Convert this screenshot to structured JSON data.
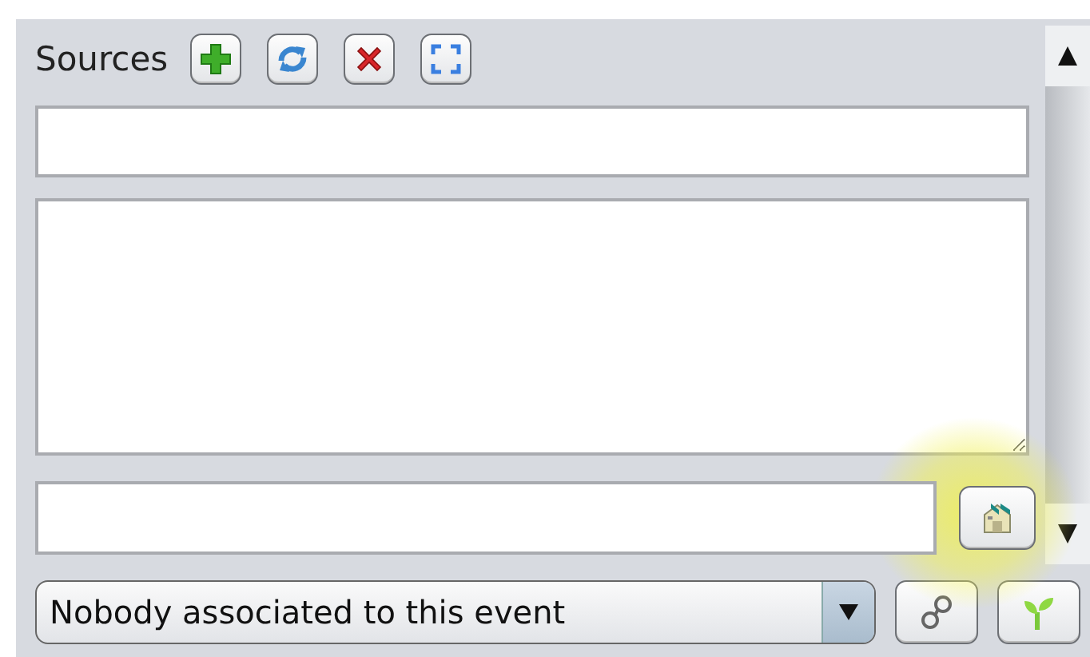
{
  "header": {
    "title": "Sources"
  },
  "combo": {
    "value": "Nobody associated to this event"
  }
}
